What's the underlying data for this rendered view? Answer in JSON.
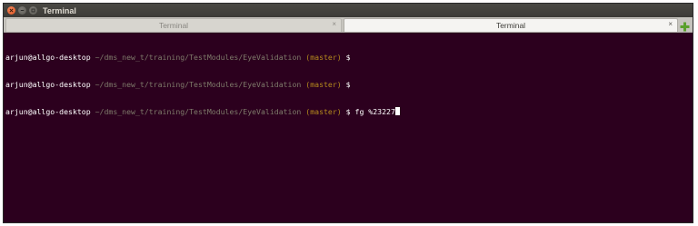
{
  "window": {
    "title": "Terminal",
    "buttons": [
      "close-icon",
      "minimize-icon",
      "maximize-icon"
    ]
  },
  "tabs": [
    {
      "label": "Terminal",
      "active": false,
      "close": "×"
    },
    {
      "label": "Terminal",
      "active": true,
      "close": "×"
    }
  ],
  "new_tab_icon": "plus-icon",
  "terminal": {
    "lines": [
      {
        "user": "arjun@allgo-desktop",
        "path": " ~/dms_new_t/training/TestModules/EyeValidation",
        "branch": " (master)",
        "prompt": " $",
        "command": ""
      },
      {
        "user": "arjun@allgo-desktop",
        "path": " ~/dms_new_t/training/TestModules/EyeValidation",
        "branch": " (master)",
        "prompt": " $",
        "command": ""
      },
      {
        "user": "arjun@allgo-desktop",
        "path": " ~/dms_new_t/training/TestModules/EyeValidation",
        "branch": " (master)",
        "prompt": " $",
        "command": " fg %23227"
      }
    ]
  },
  "colors": {
    "terminal_bg": "#2c001e",
    "path": "#7e7a6a",
    "branch": "#b58a1d",
    "close_button": "#e3531d",
    "new_tab_plus": "#5aa02c"
  }
}
